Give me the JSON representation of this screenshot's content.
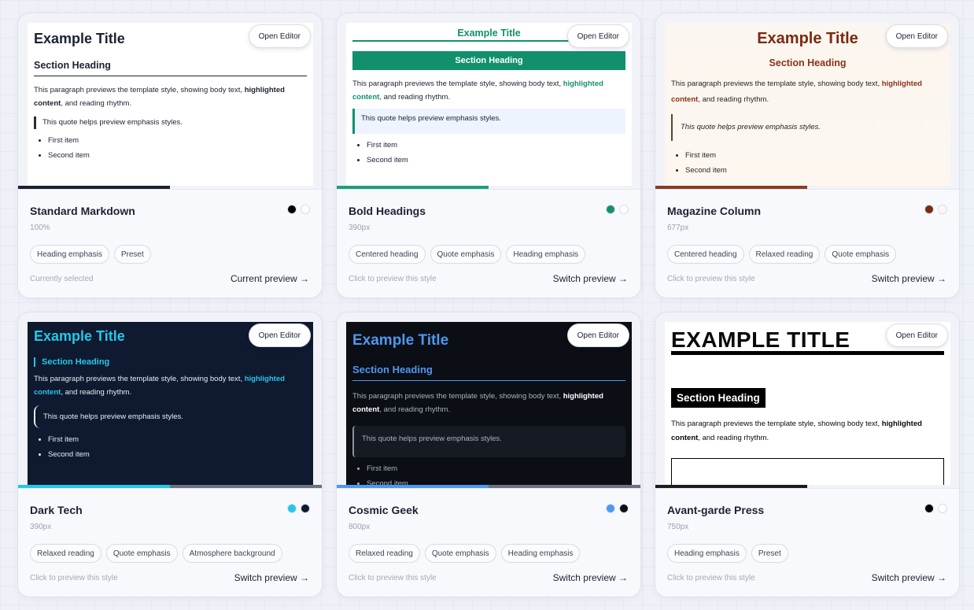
{
  "common": {
    "open_editor": "Open Editor",
    "sample": {
      "title": "Example Title",
      "heading": "Section Heading",
      "para_before": "This paragraph previews the template style, showing body text, ",
      "para_bold": "highlighted content",
      "para_after": ", and reading rhythm.",
      "quote": "This quote helps preview emphasis styles.",
      "items": [
        "First item",
        "Second item"
      ]
    }
  },
  "cards": [
    {
      "name": "Standard Markdown",
      "meta": "100%",
      "tags": [
        "Heading emphasis",
        "Preset"
      ],
      "hint": "Currently selected",
      "action": "Current preview →",
      "swatches": [
        "#000000",
        "#ffffff"
      ],
      "progress": 0.5,
      "progress_color": "#1c2233",
      "progress_rest": "#f1f3f8"
    },
    {
      "name": "Bold Headings",
      "meta": "390px",
      "tags": [
        "Centered heading",
        "Quote emphasis",
        "Heading emphasis"
      ],
      "hint": "Click to preview this style",
      "action": "Switch preview →",
      "swatches": [
        "#12906e",
        "#ffffff"
      ],
      "progress": 0.5,
      "progress_color": "#1aa07b",
      "progress_rest": "#f1f3f8"
    },
    {
      "name": "Magazine Column",
      "meta": "677px",
      "tags": [
        "Centered heading",
        "Relaxed reading",
        "Quote emphasis"
      ],
      "hint": "Click to preview this style",
      "action": "Switch preview →",
      "swatches": [
        "#7a2a12",
        "#fdf7f0"
      ],
      "progress": 0.5,
      "progress_color": "#8a3a24",
      "progress_rest": "#f1f3f8"
    },
    {
      "name": "Dark Tech",
      "meta": "390px",
      "tags": [
        "Relaxed reading",
        "Quote emphasis",
        "Atmosphere background"
      ],
      "hint": "Click to preview this style",
      "action": "Switch preview →",
      "swatches": [
        "#22c9e8",
        "#0f1930"
      ],
      "progress": 0.5,
      "progress_color": "#22c9e8",
      "progress_rest": "#6b717d"
    },
    {
      "name": "Cosmic Geek",
      "meta": "800px",
      "tags": [
        "Relaxed reading",
        "Quote emphasis",
        "Heading emphasis"
      ],
      "hint": "Click to preview this style",
      "action": "Switch preview →",
      "swatches": [
        "#4f97ef",
        "#0b0e14"
      ],
      "progress": 0.5,
      "progress_color": "#4f97ef",
      "progress_rest": "#6b717d"
    },
    {
      "name": "Avant-garde Press",
      "meta": "750px",
      "tags": [
        "Heading emphasis",
        "Preset"
      ],
      "hint": "Click to preview this style",
      "action": "Switch preview →",
      "swatches": [
        "#000000",
        "#ffffff"
      ],
      "progress": 0.5,
      "progress_color": "#1c1c1c",
      "progress_rest": "#f1f3f8"
    }
  ]
}
